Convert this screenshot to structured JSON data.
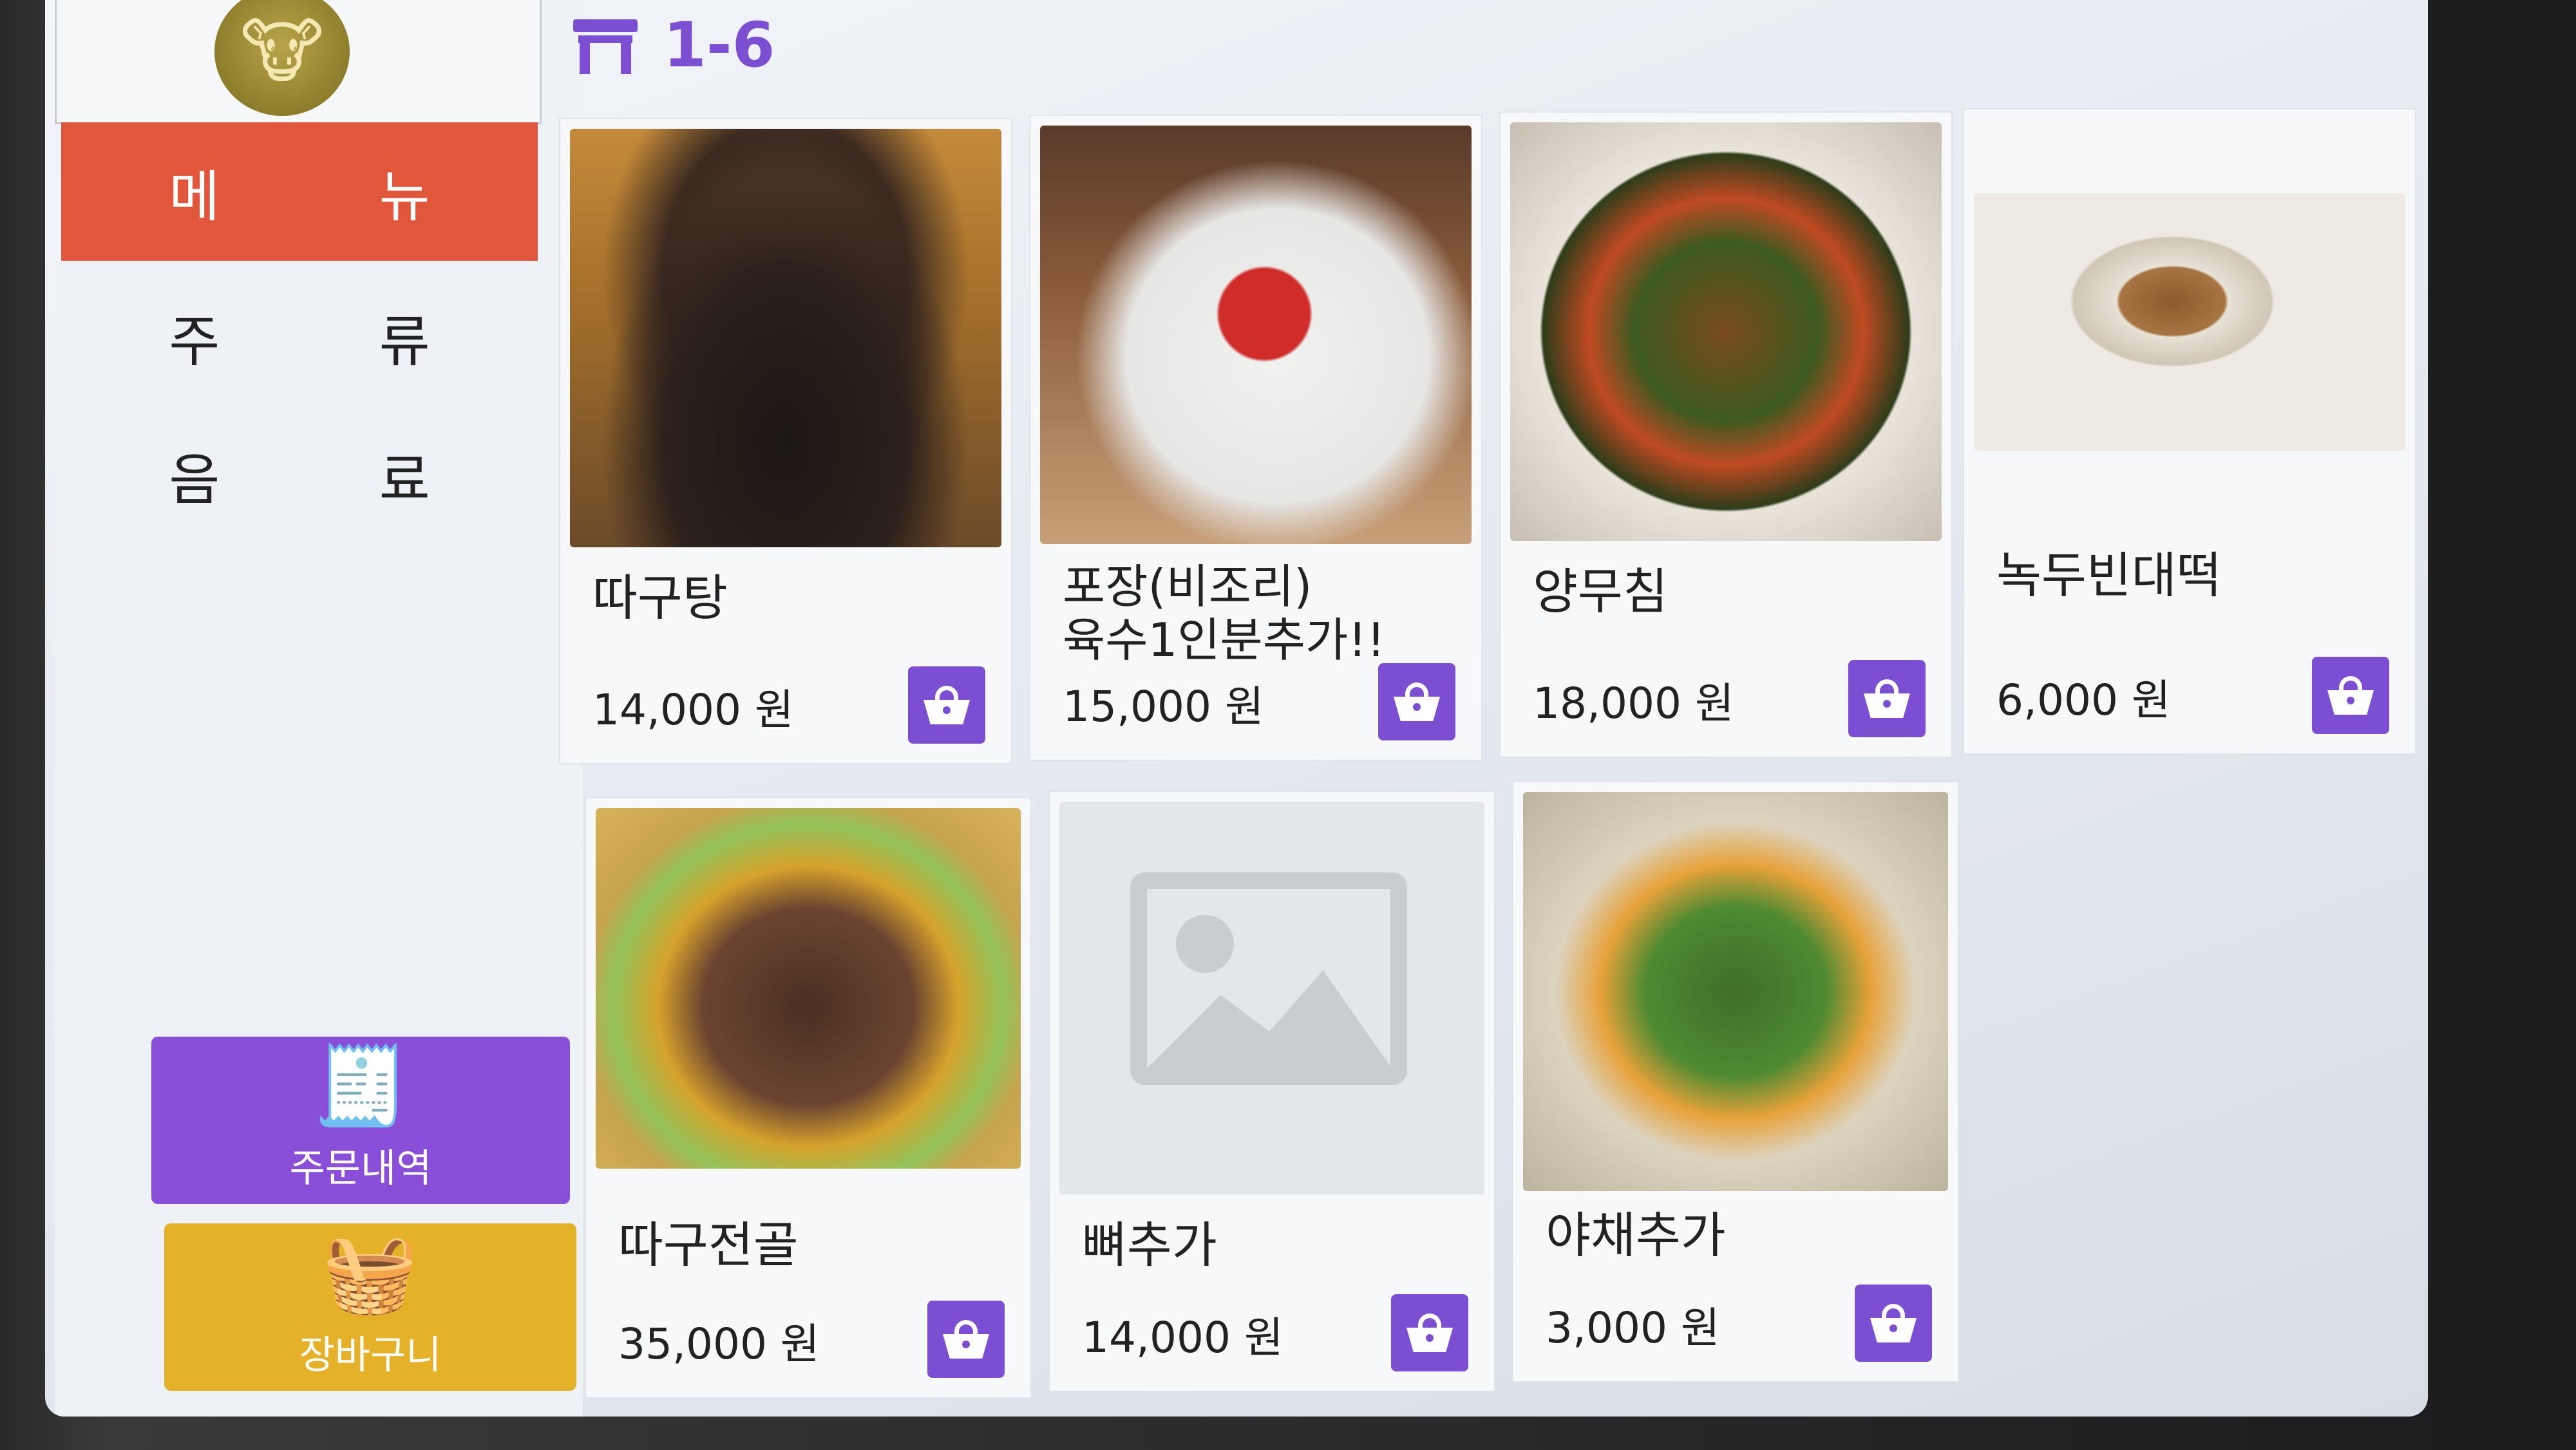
{
  "header": {
    "table_number": "1-6"
  },
  "sidebar": {
    "categories": [
      {
        "label": "메 뉴",
        "active": true
      },
      {
        "label": "주 류",
        "active": false
      },
      {
        "label": "음 료",
        "active": false
      }
    ],
    "orders_button": "주문내역",
    "cart_button": "장바구니"
  },
  "menu": [
    {
      "name": "따구탕",
      "price": "14,000 원"
    },
    {
      "name": "포장(비조리)\n육수1인분추가!!",
      "price": "15,000 원"
    },
    {
      "name": "양무침",
      "price": "18,000 원"
    },
    {
      "name": "녹두빈대떡",
      "price": "6,000 원"
    },
    {
      "name": "따구전골",
      "price": "35,000 원"
    },
    {
      "name": "뼈추가",
      "price": "14,000 원"
    },
    {
      "name": "야채추가",
      "price": "3,000 원"
    }
  ],
  "theme": {
    "accent": "#7c4fd2",
    "active_tab": "#e2573b",
    "cart": "#e4b128"
  }
}
